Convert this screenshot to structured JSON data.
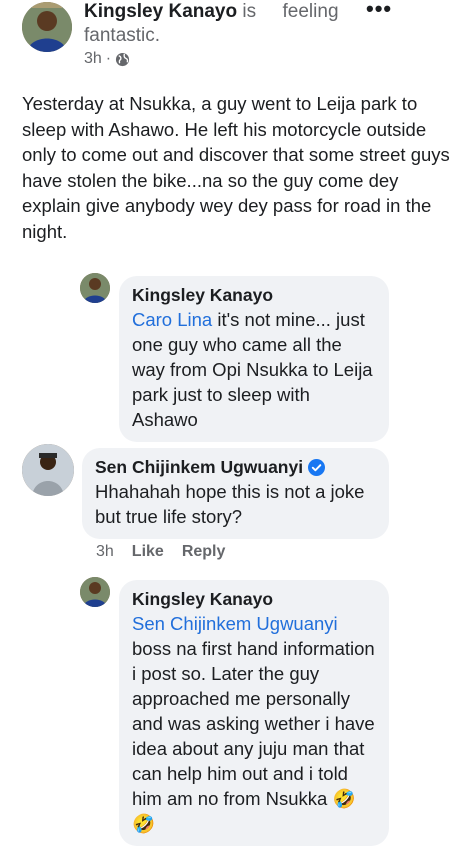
{
  "post": {
    "author": "Kingsley Kanayo",
    "feeling_prefix": " is",
    "feeling_word": "feeling",
    "feeling_value": "fantastic.",
    "time": "3h",
    "privacy_icon": "globe-icon",
    "more_icon": "more-dots-icon",
    "body": "Yesterday at Nsukka, a guy went to Leija park to sleep with Ashawo. He left his motorcycle outside only to come out and discover that some street guys have stolen the bike...na so the guy come dey explain give anybody wey dey pass for road in the night."
  },
  "comments": [
    {
      "author": "Kingsley Kanayo",
      "mention": "Caro Lina",
      "text": " it's not mine... just one guy who came all the way from Opi Nsukka to Leija park just to sleep with Ashawo"
    },
    {
      "author": "Sen Chijinkem Ugwuanyi",
      "verified": true,
      "text": "Hhahahah hope this is not a joke but true life story?",
      "time": "3h",
      "like_label": "Like",
      "reply_label": "Reply"
    },
    {
      "author": "Kingsley Kanayo",
      "mention": "Sen Chijinkem Ugwuanyi",
      "text": "boss na first hand information i post so. Later the guy approached me personally and was asking wether i have idea about any juju man that can help him out and i told him am no from Nsukka",
      "emoji": "🤣🤣"
    }
  ],
  "colors": {
    "mention": "#216fdb",
    "bubble": "#f0f2f5",
    "meta": "#65676b",
    "verified": "#1877f2"
  }
}
